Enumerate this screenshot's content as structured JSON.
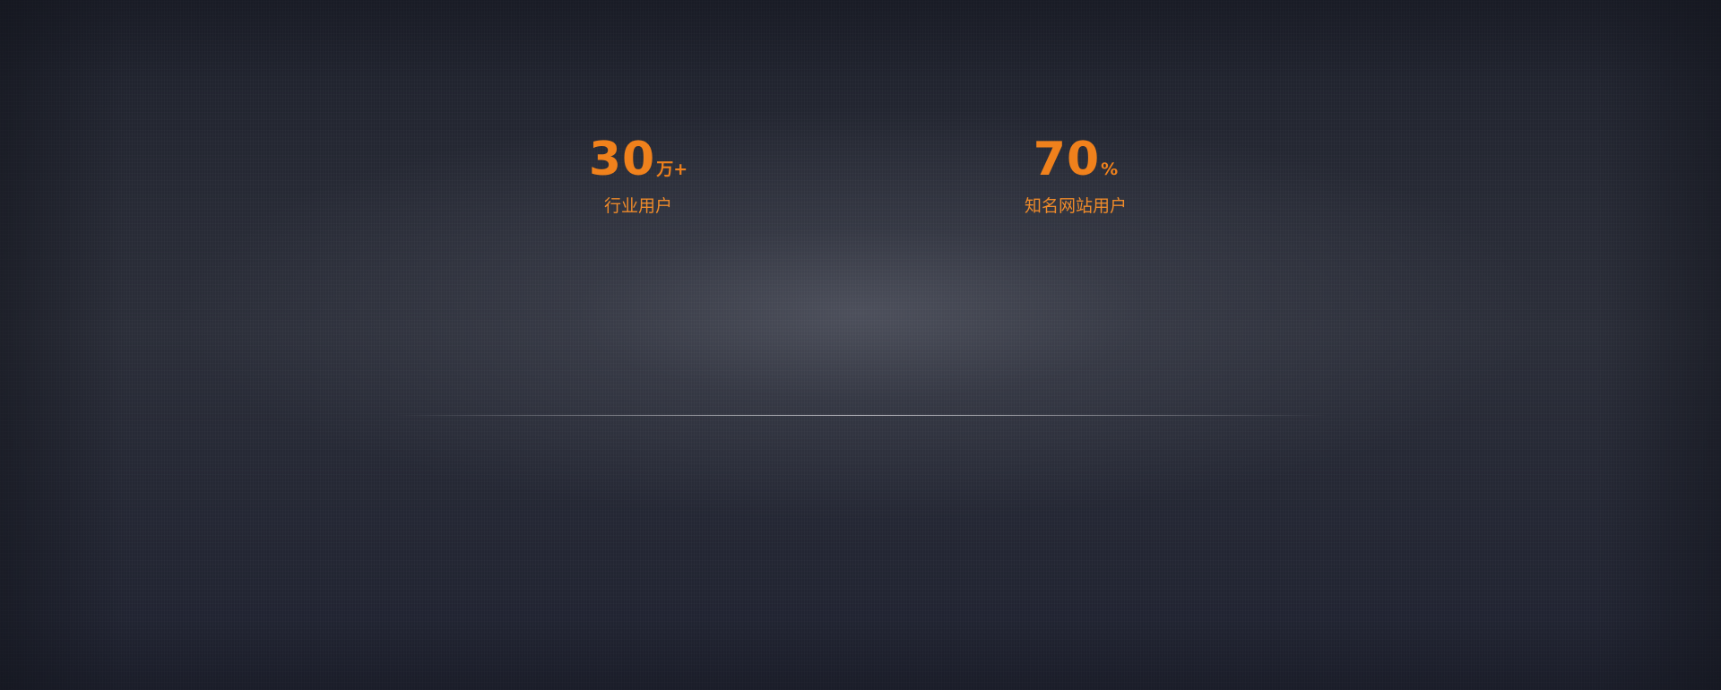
{
  "theme": {
    "accent": "#f0811c",
    "background": "#21242f",
    "divider": "#c8c8cd"
  },
  "stats": [
    {
      "number": "30",
      "unit": "万+",
      "label": "行业用户"
    },
    {
      "number": "70",
      "unit": "%",
      "label": "知名网站用户"
    }
  ]
}
